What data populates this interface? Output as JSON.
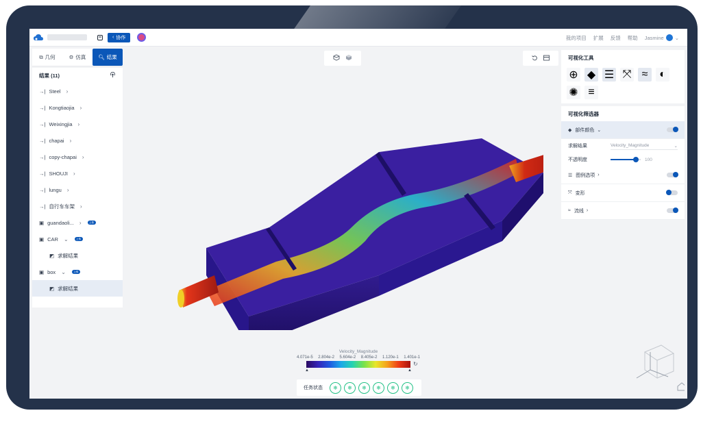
{
  "header": {
    "collab_label": "协作",
    "nav": [
      "我的项目",
      "扩展",
      "反馈",
      "帮助"
    ],
    "username": "Jasmine"
  },
  "left_tabs": [
    {
      "label": "几何",
      "icon": "geometry-icon"
    },
    {
      "label": "仿真",
      "icon": "simulation-icon"
    },
    {
      "label": "结果",
      "icon": "results-icon"
    }
  ],
  "results": {
    "title": "结果 (11)",
    "items": [
      {
        "label": "Steel",
        "type": "import"
      },
      {
        "label": "Kongtiaojia",
        "type": "import"
      },
      {
        "label": "Weixingjia",
        "type": "import"
      },
      {
        "label": "chapai",
        "type": "import"
      },
      {
        "label": "copy-chapai",
        "type": "import"
      },
      {
        "label": "SHOUJI",
        "type": "import"
      },
      {
        "label": "lungu",
        "type": "import"
      },
      {
        "label": "自行车车架",
        "type": "import"
      },
      {
        "label": "guandaoli...",
        "type": "folder",
        "badge": "上传"
      },
      {
        "label": "CAR",
        "type": "folder",
        "badge": "上传",
        "expanded": true
      },
      {
        "label": "求解结果",
        "type": "child"
      },
      {
        "label": "box",
        "type": "folder",
        "badge": "上传",
        "expanded": true
      },
      {
        "label": "求解结果",
        "type": "child",
        "selected": true
      }
    ]
  },
  "viz_tools": {
    "title": "可视化工具"
  },
  "viz_filters": {
    "title": "可视化筛选器",
    "part_color": "部件颜色",
    "solve_result_label": "求解结果",
    "solve_result_value": "Velocity_Magnitude",
    "opacity_label": "不透明度",
    "opacity_value": "100",
    "opacity_fraction": 0.85,
    "legend_options": "图例选项",
    "deform": "变形",
    "streamline": "流线"
  },
  "legend": {
    "title": "Velocity_Magnitude",
    "ticks": [
      "4.071e-5",
      "2.804e-2",
      "5.604e-2",
      "8.405e-2",
      "1.120e-1",
      "1.401e-1"
    ]
  },
  "status": {
    "label": "任务状态",
    "count": 6
  },
  "colors": {
    "accent": "#0b57b8",
    "status_ok": "#23c186",
    "bezel": "#24324a"
  }
}
